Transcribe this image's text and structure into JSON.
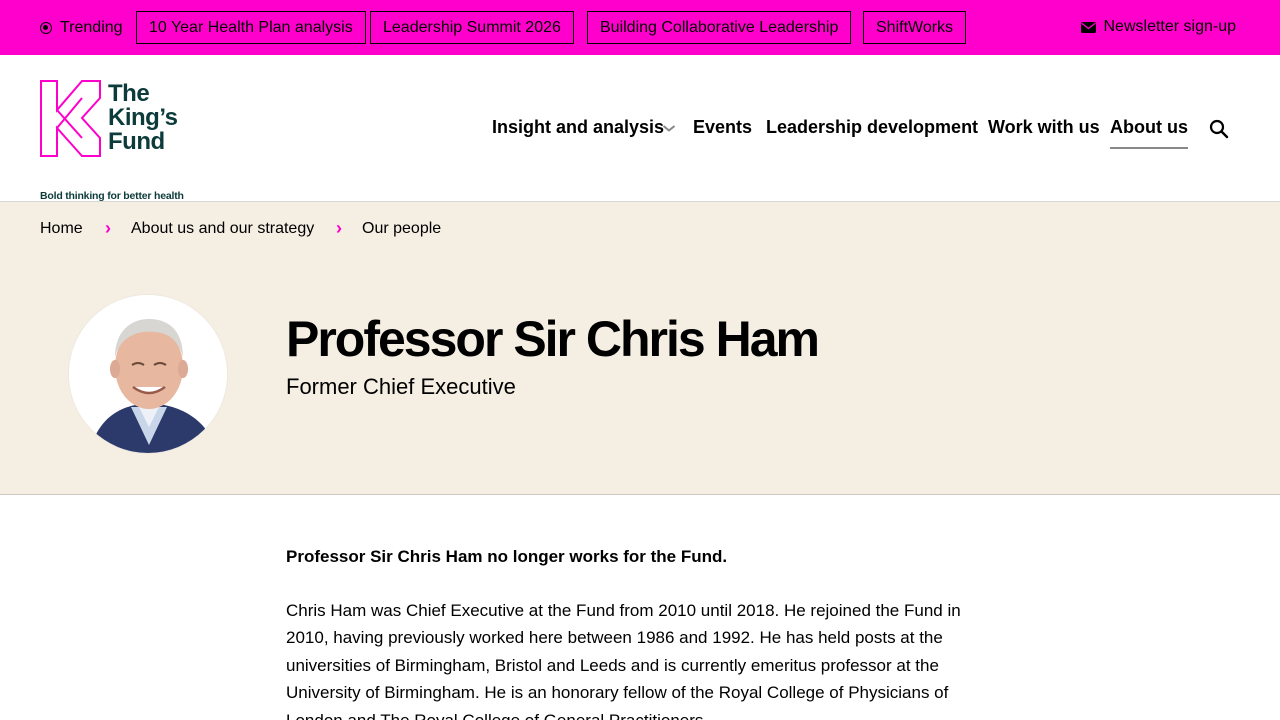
{
  "topbar": {
    "trending_label": "Trending",
    "pills": [
      "10 Year Health Plan analysis",
      "Leadership Summit 2026",
      "Building Collaborative Leadership",
      "ShiftWorks"
    ],
    "newsletter_label": "Newsletter sign-up",
    "background_color": "#ff00cc"
  },
  "logo": {
    "line1": "The",
    "line2": "King’s",
    "line3": "Fund",
    "tagline": "Bold thinking for better health",
    "color": "#0d3b3b",
    "mark_color": "#ff00cc"
  },
  "nav": {
    "items": [
      "Insight and analysis",
      "Events",
      "Leadership development",
      "Work with us",
      "About us"
    ],
    "active": "About us",
    "icons": [
      "chevron-down-icon",
      "search-icon"
    ]
  },
  "breadcrumb": [
    "Home",
    "About us and our strategy",
    "Our people"
  ],
  "profile": {
    "name": "Professor Sir Chris Ham",
    "role": "Former Chief Executive",
    "hero_background": "#f5eee3"
  },
  "content": {
    "notice": "Professor Sir Chris Ham no longer works for the Fund.",
    "bio": "Chris Ham was Chief Executive at the Fund from 2010 until 2018. He rejoined the Fund in 2010, having previously worked here between 1986 and 1992. He has held posts at the universities of Birmingham, Bristol and Leeds and is currently emeritus professor at the University of Birmingham. He is an honorary fellow of the Royal College of Physicians of London and The Royal College of General Practitioners."
  }
}
